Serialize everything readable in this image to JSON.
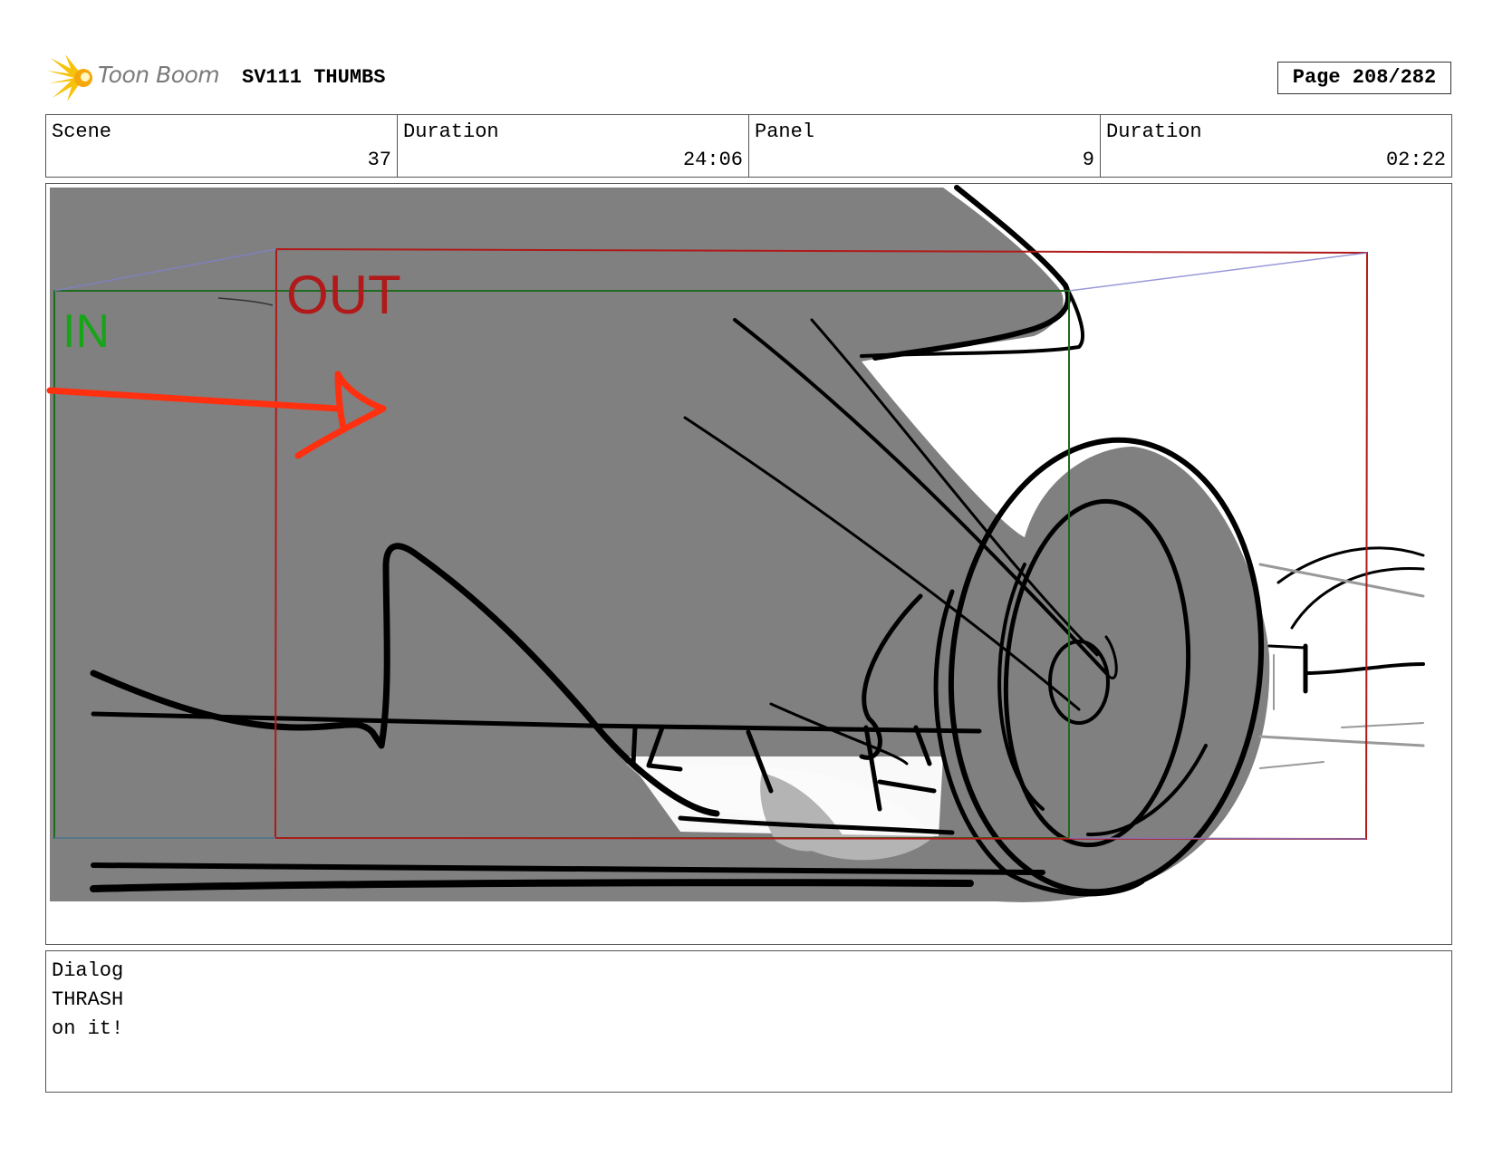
{
  "header": {
    "logo_text": "Toon Boom",
    "project_title": "SV111 THUMBS",
    "page_label": "Page 208/282"
  },
  "info": {
    "scene": {
      "label": "Scene",
      "value": "37"
    },
    "scene_duration": {
      "label": "Duration",
      "value": "24:06"
    },
    "panel": {
      "label": "Panel",
      "value": "9"
    },
    "panel_duration": {
      "label": "Duration",
      "value": "02:22"
    }
  },
  "panel_image": {
    "in_label": "IN",
    "out_label": "OUT",
    "colors": {
      "in_frame": "#1f6b1f",
      "in_text": "#18a418",
      "out_frame": "#b01a1a",
      "out_text": "#b01a1a",
      "arrow": "#ff3010",
      "fill_gray": "#808080",
      "light_gray": "#b4b4b4"
    }
  },
  "dialog": {
    "label": "Dialog",
    "character": "THRASH",
    "line": "on it!"
  }
}
